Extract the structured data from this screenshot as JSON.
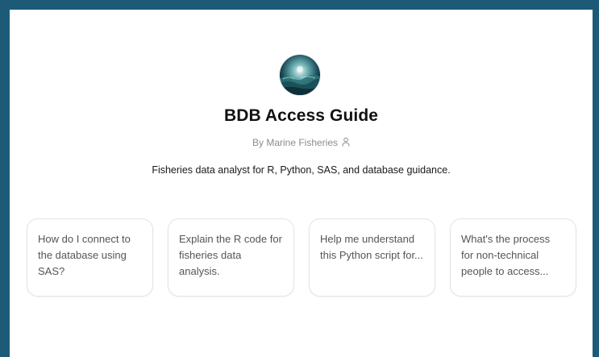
{
  "gpt": {
    "name": "BDB Access Guide",
    "byline": "By Marine Fisheries",
    "description": "Fisheries data analyst for R, Python, SAS, and database guidance.",
    "avatar_icon": "ocean-wave-avatar",
    "byline_icon": "person-icon"
  },
  "suggestions": [
    {
      "text": "How do I connect to the database using SAS?"
    },
    {
      "text": "Explain the R code for fisheries data analysis."
    },
    {
      "text": "Help me understand this Python script for..."
    },
    {
      "text": "What's the process for non-technical people to access..."
    }
  ],
  "colors": {
    "frame_border": "#1c5a78",
    "background": "#ffffff",
    "title_text": "#111111",
    "byline_text": "#8c8c8c",
    "card_border": "#e3e3e3",
    "card_text": "#555555"
  }
}
